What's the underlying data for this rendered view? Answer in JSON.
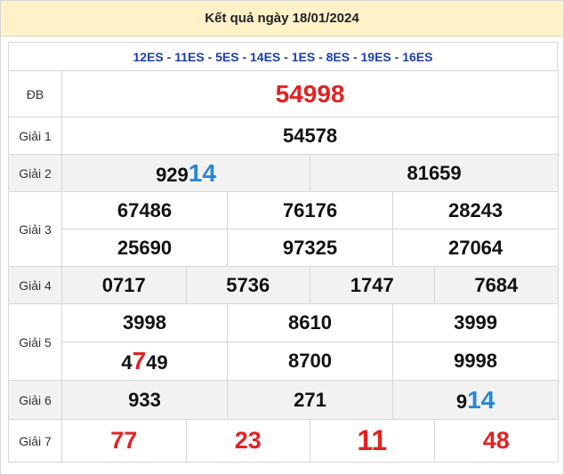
{
  "header": {
    "title": "Kết quả ngày 18/01/2024"
  },
  "codes": "12ES - 11ES - 5ES - 14ES - 1ES - 8ES - 19ES - 16ES",
  "labels": {
    "db": "ĐB",
    "g1": "Giải 1",
    "g2": "Giải 2",
    "g3": "Giải 3",
    "g4": "Giải 4",
    "g5": "Giải 5",
    "g6": "Giải 6",
    "g7": "Giải 7"
  },
  "prizes": {
    "db": "54998",
    "g1": "54578",
    "g2": [
      {
        "head": "929",
        "tail": "14"
      },
      {
        "head": "81659",
        "tail": ""
      }
    ],
    "g3": [
      "67486",
      "76176",
      "28243",
      "25690",
      "97325",
      "27064"
    ],
    "g4": [
      "0717",
      "5736",
      "1747",
      "7684"
    ],
    "g5": [
      {
        "a": "3998",
        "b": "",
        "c": ""
      },
      {
        "a": "8610",
        "b": "",
        "c": ""
      },
      {
        "a": "3999",
        "b": "",
        "c": ""
      },
      {
        "a": "4",
        "b": "7",
        "c": "49"
      },
      {
        "a": "8700",
        "b": "",
        "c": ""
      },
      {
        "a": "9998",
        "b": "",
        "c": ""
      }
    ],
    "g6": [
      {
        "head": "933",
        "tail": ""
      },
      {
        "head": "271",
        "tail": ""
      },
      {
        "head": "9",
        "tail": "14"
      }
    ],
    "g7": [
      "77",
      "23",
      "11",
      "48"
    ]
  },
  "colors": {
    "special": "#e22222",
    "highlight_blue": "#2b86d6",
    "codes_blue": "#1e3ea8",
    "header_bg": "#fff2c9"
  }
}
